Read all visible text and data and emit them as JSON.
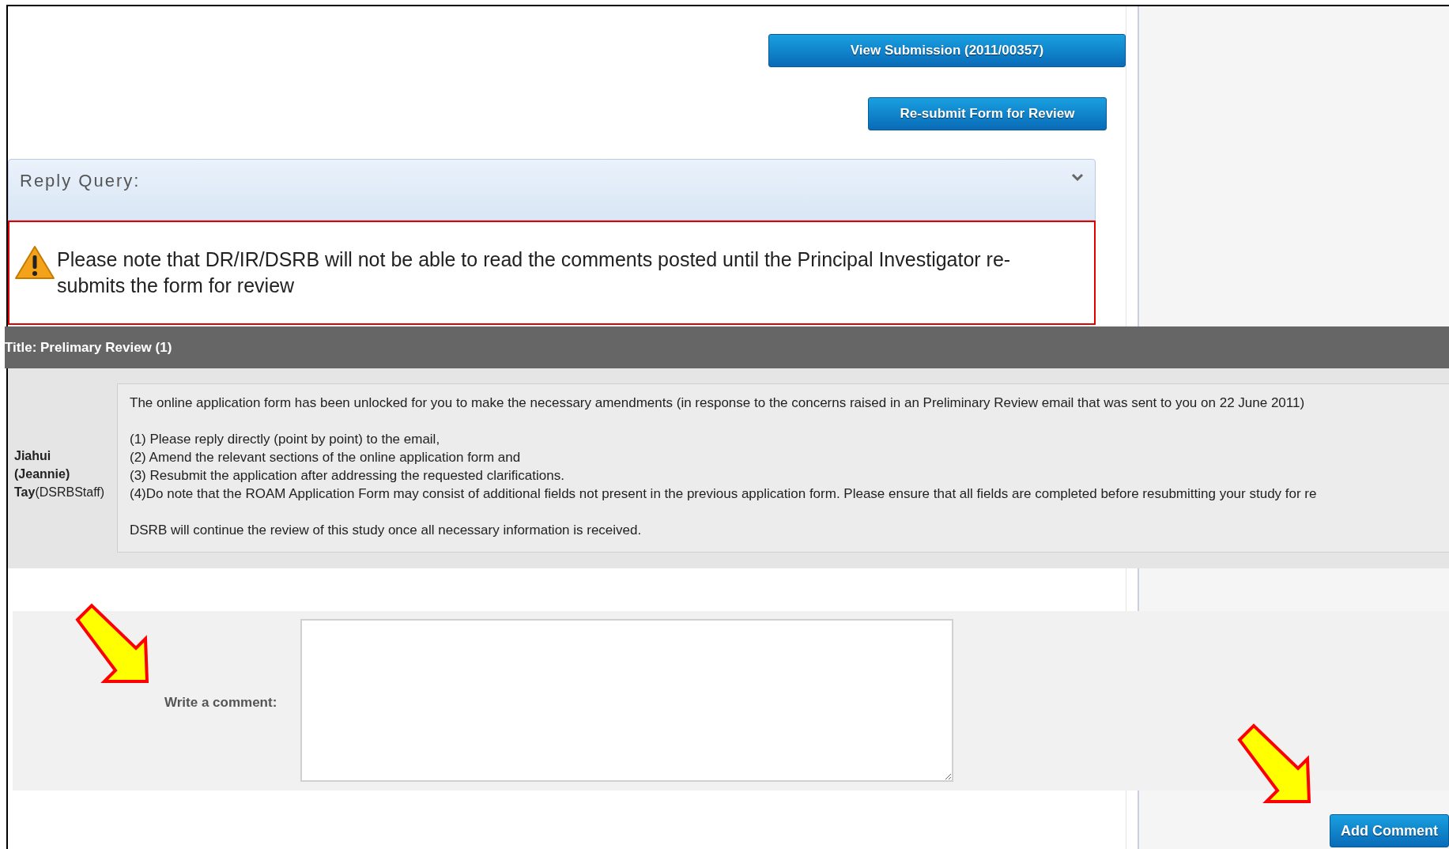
{
  "header_buttons": [
    {
      "label": "View Submission (2011/00357)",
      "kind": "wide"
    },
    {
      "label": "Re-submit Form for Review",
      "kind": "narrow"
    }
  ],
  "reply_panel": {
    "title": "Reply Query:",
    "notice": "Please note that DR/IR/DSRB will not be able to read the comments posted until the Principal Investigator re-submits the form for review"
  },
  "thread": {
    "title": "Title: Prelimary Review (1)",
    "author": "**Jiahui (Jeannie) Tay**(DSRBStaff)",
    "paragraphs": [
      [
        "The online application form has been unlocked for you to make the necessary amendments (in response to the concerns raised in an Preliminary Review email that was sent to you on 22 June 2011)"
      ],
      [
        "(1) Please reply directly (point by point) to the email,",
        "(2) Amend the relevant sections of the online application form and",
        "(3) Resubmit the application after addressing the requested clarifications.",
        "(4)Do note that the ROAM Application Form may consist of additional fields not present in the previous application form. Please ensure that all fields are completed before resubmitting your study for re"
      ],
      [
        "DSRB will continue the review of this study once all necessary information is received."
      ]
    ]
  },
  "comment_form": {
    "label": "Write a comment:",
    "button": "Add Comment"
  }
}
